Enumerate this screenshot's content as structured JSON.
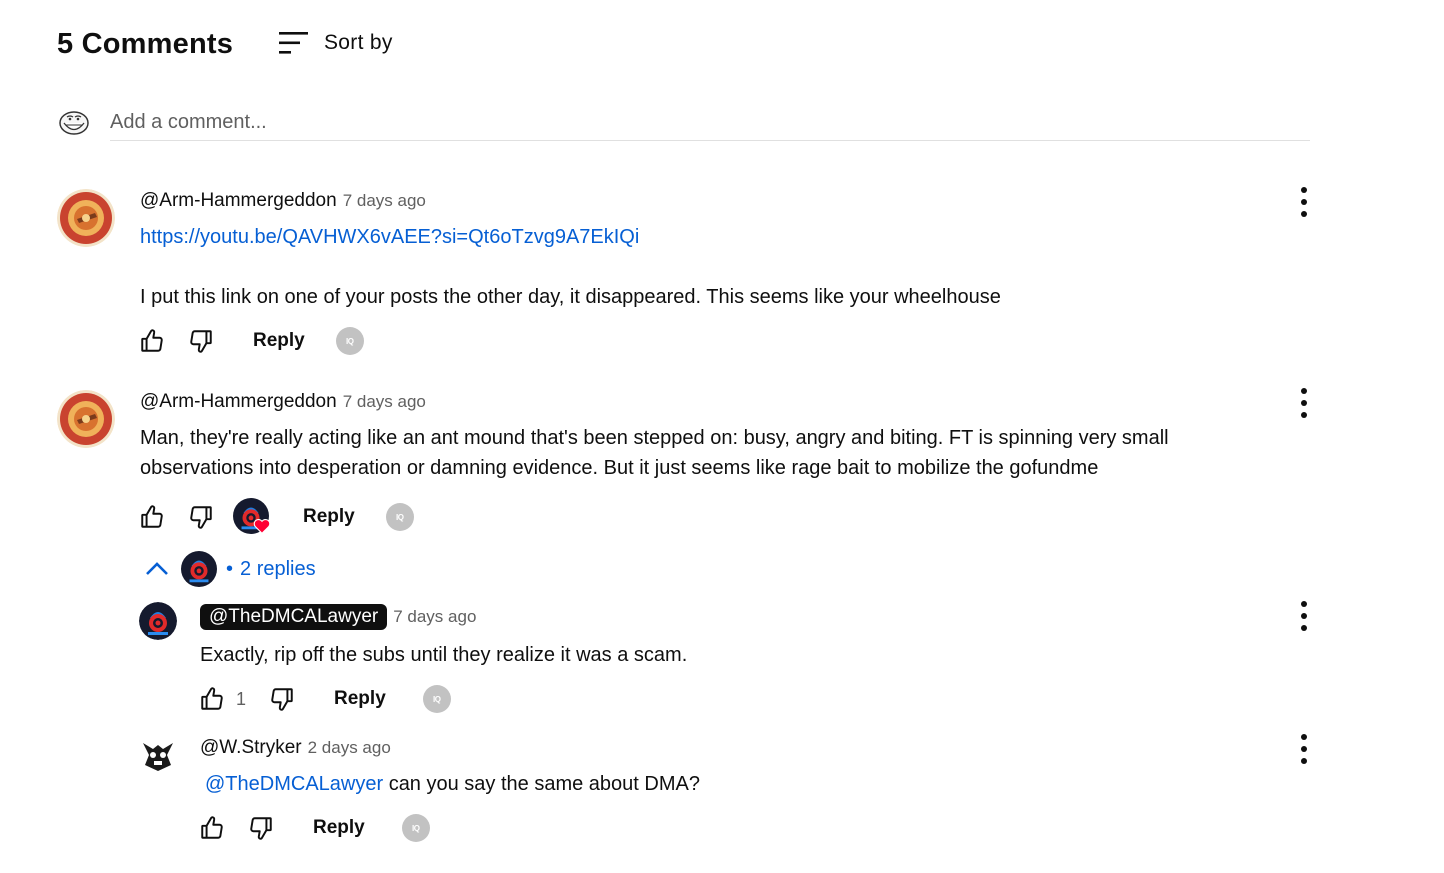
{
  "header": {
    "title": "5 Comments",
    "sort_label": "Sort by"
  },
  "add_comment": {
    "placeholder": "Add a comment..."
  },
  "comments": [
    {
      "author": "@Arm-Hammergeddon",
      "time": "7 days ago",
      "link": "https://youtu.be/QAVHWX6vAEE?si=Qt6oTzvg9A7EkIQi",
      "text": "I put this link on one of your posts the other day, it disappeared. This seems like your wheelhouse",
      "reply_label": "Reply"
    },
    {
      "author": "@Arm-Hammergeddon",
      "time": "7 days ago",
      "text_line1": "Man, they're really acting like an ant mound that's been stepped on: busy, angry and biting. FT is spinning very small",
      "text_line2": "observations into desperation or damning evidence. But it just seems like rage bait to mobilize the gofundme",
      "reply_label": "Reply",
      "replies_toggle": "2 replies",
      "replies_separator": "•"
    }
  ],
  "replies": [
    {
      "author": "@TheDMCALawyer",
      "time": "7 days ago",
      "text": "Exactly, rip off the subs until they realize it was a scam.",
      "likes": "1",
      "reply_label": "Reply"
    },
    {
      "author": "@W.Stryker",
      "time": "2 days ago",
      "mention": "@TheDMCALawyer",
      "text": "can you say the same about DMA?",
      "reply_label": "Reply"
    }
  ],
  "colors": {
    "link": "#065fd4",
    "text": "#0f0f0f",
    "secondary": "#606060",
    "heart": "#ff0033"
  },
  "icons": [
    "sort-icon",
    "like-icon",
    "dislike-icon",
    "more-vert-icon",
    "chevron-up-icon",
    "heart-icon",
    "iq-badge-icon"
  ]
}
